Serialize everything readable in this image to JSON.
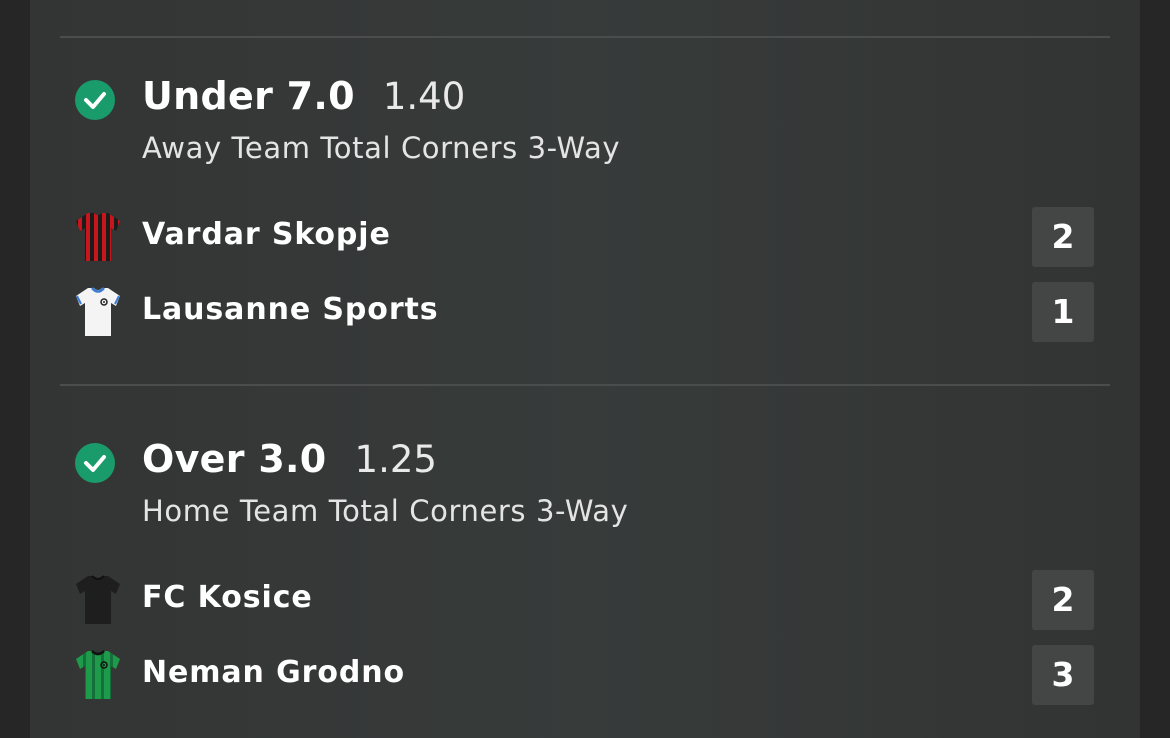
{
  "bets": [
    {
      "status": "won",
      "selection": "Under 7.0",
      "odds": "1.40",
      "market": "Away Team Total Corners 3-Way",
      "teams": [
        {
          "name": "Vardar Skopje",
          "score": "2",
          "shirt": "red-black-striped-shirt-icon"
        },
        {
          "name": "Lausanne Sports",
          "score": "1",
          "shirt": "white-shirt-icon"
        }
      ]
    },
    {
      "status": "won",
      "selection": "Over 3.0",
      "odds": "1.25",
      "market": "Home Team Total Corners 3-Way",
      "teams": [
        {
          "name": "FC Kosice",
          "score": "2",
          "shirt": "black-shirt-icon"
        },
        {
          "name": "Neman Grodno",
          "score": "3",
          "shirt": "green-striped-shirt-icon"
        }
      ]
    }
  ],
  "colors": {
    "check_green": "#1a9b6b",
    "score_box": "#434645",
    "card_bg": "#353837"
  }
}
